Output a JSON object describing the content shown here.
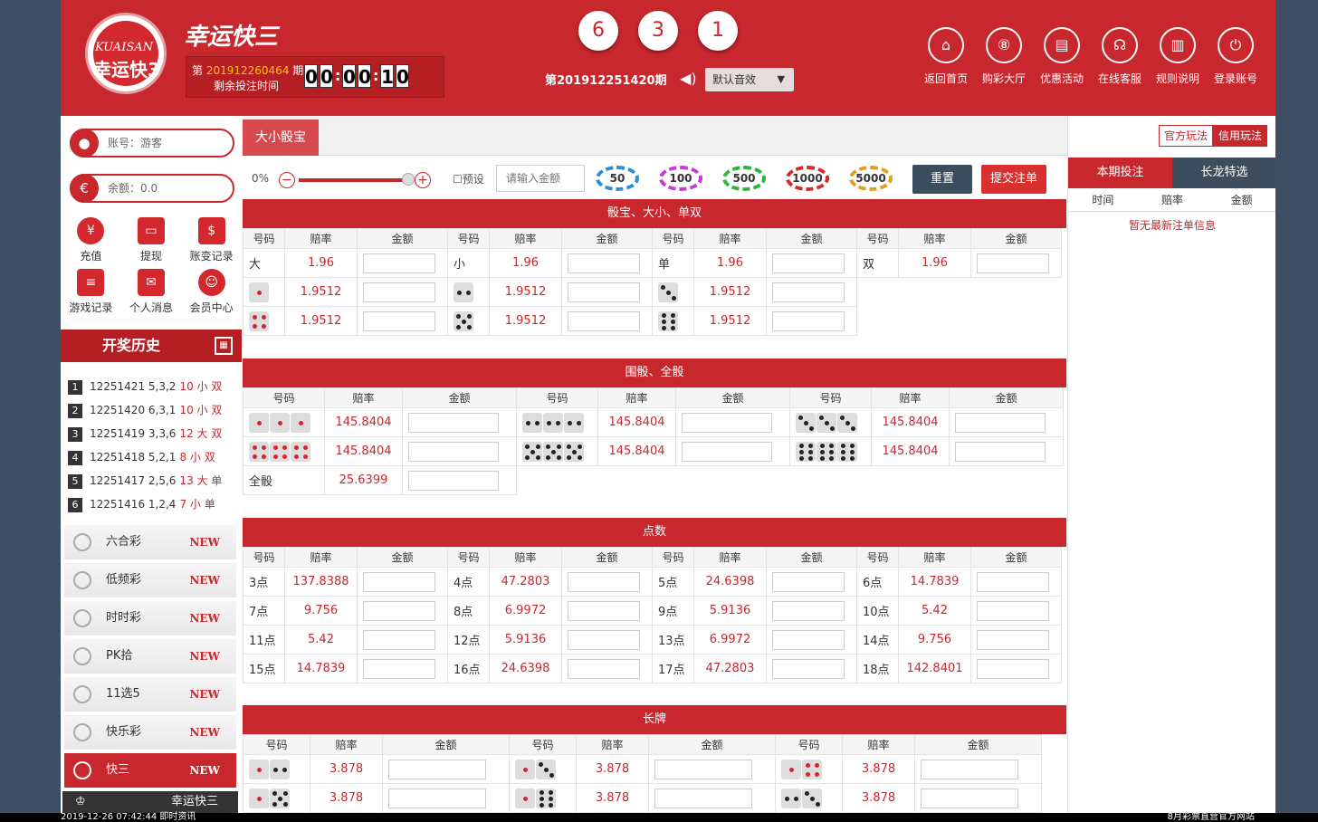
{
  "header": {
    "logo_en": "KUAISAN",
    "logo_cn": "幸运快3",
    "title": "幸运快三",
    "period_prefix": "第",
    "period_num": "201912260464",
    "period_suffix": "期",
    "remaining_label": "剩余投注时间",
    "countdown": [
      "0",
      "0",
      ":",
      "0",
      "0",
      ":",
      "1",
      "0"
    ],
    "balls": [
      "6",
      "3",
      "1"
    ],
    "current_period": "第201912251420期",
    "sound_label": "默认音效",
    "nav": [
      {
        "label": "返回首页",
        "icon": "home-icon",
        "glyph": "⌂"
      },
      {
        "label": "购彩大厅",
        "icon": "lottery-hall-icon",
        "glyph": "⑧"
      },
      {
        "label": "优惠活动",
        "icon": "promo-icon",
        "glyph": "▤"
      },
      {
        "label": "在线客服",
        "icon": "headset-icon",
        "glyph": "☊"
      },
      {
        "label": "规则说明",
        "icon": "rules-icon",
        "glyph": "▥"
      },
      {
        "label": "登录账号",
        "icon": "power-icon",
        "glyph": "⏻"
      }
    ]
  },
  "sidebar": {
    "account": "账号：游客",
    "balance": "余额：0.0",
    "actions": [
      {
        "label": "充值",
        "icon": "recharge-icon",
        "glyph": "¥"
      },
      {
        "label": "提现",
        "icon": "withdraw-icon",
        "glyph": "▭"
      },
      {
        "label": "账变记录",
        "icon": "ledger-icon",
        "glyph": "$"
      },
      {
        "label": "游戏记录",
        "icon": "game-record-icon",
        "glyph": "≡"
      },
      {
        "label": "个人消息",
        "icon": "message-icon",
        "glyph": "✉"
      },
      {
        "label": "会员中心",
        "icon": "member-icon",
        "glyph": "☺"
      }
    ],
    "history_title": "开奖历史",
    "history": [
      {
        "rank": "1",
        "period": "12251421",
        "nums": "5,3,2",
        "res": "10 小 双"
      },
      {
        "rank": "2",
        "period": "12251420",
        "nums": "6,3,1",
        "res": "10 小 双"
      },
      {
        "rank": "3",
        "period": "12251419",
        "nums": "3,3,6",
        "res": "12 大 双"
      },
      {
        "rank": "4",
        "period": "12251418",
        "nums": "5,2,1",
        "res": "8 小 双"
      },
      {
        "rank": "5",
        "period": "12251417",
        "nums": "2,5,6",
        "res": "13 大 单"
      },
      {
        "rank": "6",
        "period": "12251416",
        "nums": "1,2,4",
        "res": "7 小 单"
      }
    ],
    "games": [
      {
        "label": "六合彩",
        "badge": "NEW"
      },
      {
        "label": "低频彩",
        "badge": "NEW"
      },
      {
        "label": "时时彩",
        "badge": "NEW"
      },
      {
        "label": "PK拾",
        "badge": "NEW"
      },
      {
        "label": "11选5",
        "badge": "NEW"
      },
      {
        "label": "快乐彩",
        "badge": "NEW"
      },
      {
        "label": "快三",
        "badge": "NEW"
      }
    ],
    "footer_game": "幸运快三"
  },
  "main": {
    "tab": "大小骰宝",
    "pct": "0%",
    "preset": "预设",
    "amount_placeholder": "请输入金额",
    "chips": [
      "50",
      "100",
      "500",
      "1000",
      "5000"
    ],
    "reset": "重置",
    "submit": "提交注单",
    "col_num": "号码",
    "col_odds": "赔率",
    "col_amt": "金额",
    "sec1": {
      "title": "骰宝、大小、单双",
      "row1": [
        [
          "大",
          "1.96"
        ],
        [
          "小",
          "1.96"
        ],
        [
          "单",
          "1.96"
        ],
        [
          "双",
          "1.96"
        ]
      ],
      "dice_odds": "1.9512"
    },
    "sec2": {
      "title": "围骰、全骰",
      "odds": "145.8404",
      "all_label": "全骰",
      "all_odds": "25.6399"
    },
    "sec3": {
      "title": "点数",
      "rows": [
        [
          [
            "3点",
            "137.8388"
          ],
          [
            "4点",
            "47.2803"
          ],
          [
            "5点",
            "24.6398"
          ],
          [
            "6点",
            "14.7839"
          ]
        ],
        [
          [
            "7点",
            "9.756"
          ],
          [
            "8点",
            "6.9972"
          ],
          [
            "9点",
            "5.9136"
          ],
          [
            "10点",
            "5.42"
          ]
        ],
        [
          [
            "11点",
            "5.42"
          ],
          [
            "12点",
            "5.9136"
          ],
          [
            "13点",
            "6.9972"
          ],
          [
            "14点",
            "9.756"
          ]
        ],
        [
          [
            "15点",
            "14.7839"
          ],
          [
            "16点",
            "24.6398"
          ],
          [
            "17点",
            "47.2803"
          ],
          [
            "18点",
            "142.8401"
          ]
        ]
      ]
    },
    "sec4": {
      "title": "长牌",
      "odds": "3.878"
    }
  },
  "right": {
    "official": "官方玩法",
    "credit": "信用玩法",
    "tab_current": "本期投注",
    "tab_long": "长龙特选",
    "cols": [
      "时间",
      "赔率",
      "金额"
    ],
    "empty": "暂无最新注单信息"
  },
  "status": {
    "left": "2019-12-26 07:42:44   即时资讯",
    "right": "8月彩票直营官方网站"
  }
}
